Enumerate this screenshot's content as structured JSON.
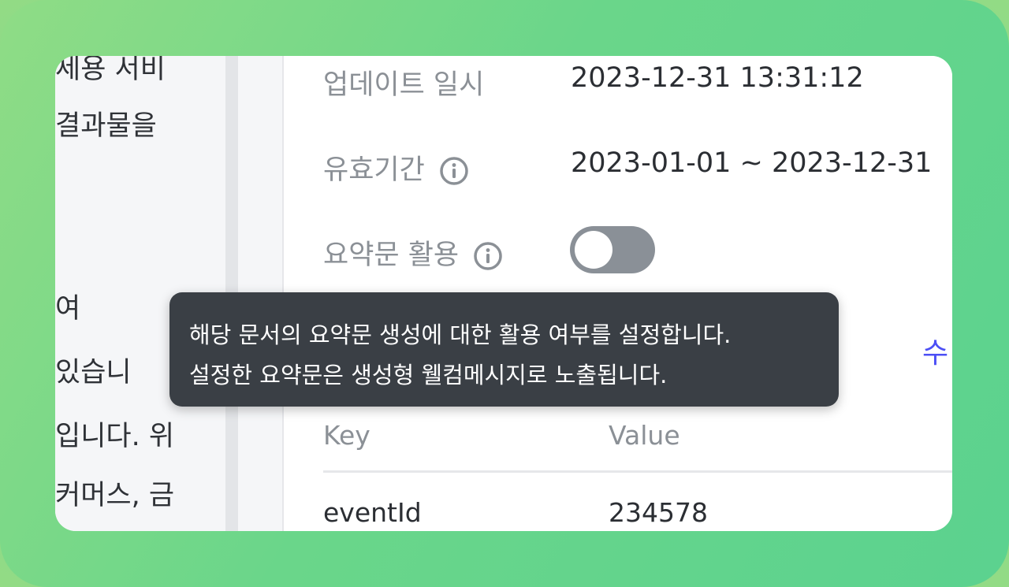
{
  "left_panel": {
    "lines": [
      "세용 서비",
      "결과물을",
      "여",
      " 있습니",
      "입니다. 위",
      "커머스, 금"
    ]
  },
  "details": {
    "updated_label": "업데이트 일시",
    "updated_value": "2023-12-31 13:31:12",
    "validity_label": "유효기간",
    "validity_value": "2023-01-01 ~ 2023-12-31",
    "summary_label": "요약문 활용",
    "summary_toggle_on": false
  },
  "edit_link_label": "수",
  "tooltip": {
    "line1": "해당 문서의 요약문 생성에 대한 활용 여부를 설정합니다.",
    "line2": "설정한 요약문은 생성형 웰컴메시지로 노출됩니다."
  },
  "table": {
    "headers": [
      "Key",
      "Value"
    ],
    "rows": [
      [
        "eventId",
        "234578"
      ]
    ]
  },
  "colors": {
    "accent": "#4c4ff5",
    "toggle_off": "#8a9097",
    "tooltip_bg": "#3a3f45"
  }
}
